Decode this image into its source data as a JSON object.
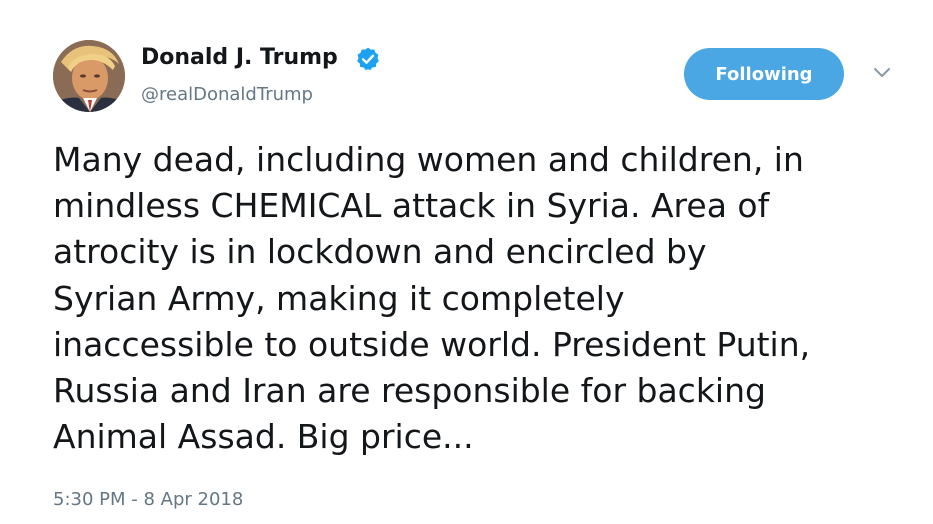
{
  "author": {
    "display_name": "Donald J. Trump",
    "handle": "@realDonaldTrump",
    "verified": true,
    "verified_icon": "verified-badge-icon"
  },
  "actions": {
    "follow_label": "Following",
    "more_icon": "chevron-down-icon"
  },
  "tweet": {
    "lines": [
      "Many dead, including women and children, in",
      "mindless CHEMICAL attack in Syria. Area of",
      "atrocity is in lockdown and encircled by",
      "Syrian Army, making it completely",
      "inaccessible to outside world. President Putin,",
      "Russia and Iran are responsible for backing",
      "Animal Assad. Big price..."
    ],
    "timestamp": "5:30 PM - 8 Apr 2018"
  },
  "colors": {
    "accent": "#1da1f2",
    "follow_button": "#4aa7e3",
    "text_primary": "#14171a",
    "text_secondary": "#657786"
  }
}
